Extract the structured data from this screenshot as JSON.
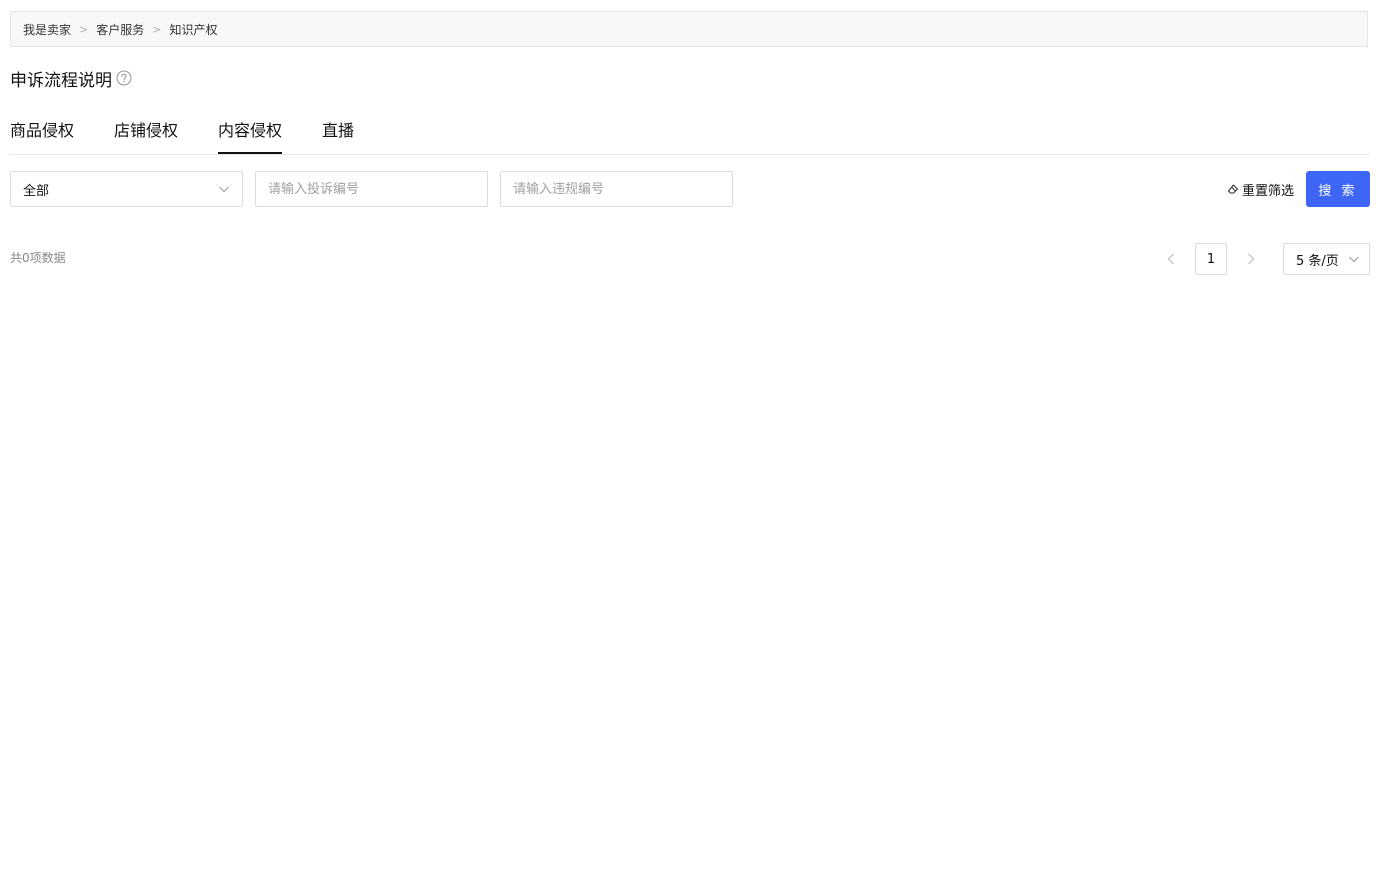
{
  "breadcrumb": [
    "我是卖家",
    "客户服务",
    "知识产权"
  ],
  "breadcrumb_separator": ">",
  "title": "申诉流程说明",
  "tabs": [
    {
      "label": "商品侵权",
      "active": false
    },
    {
      "label": "店铺侵权",
      "active": false
    },
    {
      "label": "内容侵权",
      "active": true
    },
    {
      "label": "直播",
      "active": false
    }
  ],
  "filters": {
    "status_select": {
      "value": "全部"
    },
    "complaint_input": {
      "placeholder": "请输入投诉编号",
      "value": ""
    },
    "violation_input": {
      "placeholder": "请输入违规编号",
      "value": ""
    }
  },
  "actions": {
    "reset_label": "重置筛选",
    "search_label": "搜 索"
  },
  "total_text": "共0项数据",
  "pagination": {
    "current_page": "1",
    "page_size": "5 条/页"
  },
  "colors": {
    "accent": "#3d66f6",
    "breadcrumb_bg": "#f8f8f8",
    "border": "#dcdcdc"
  }
}
